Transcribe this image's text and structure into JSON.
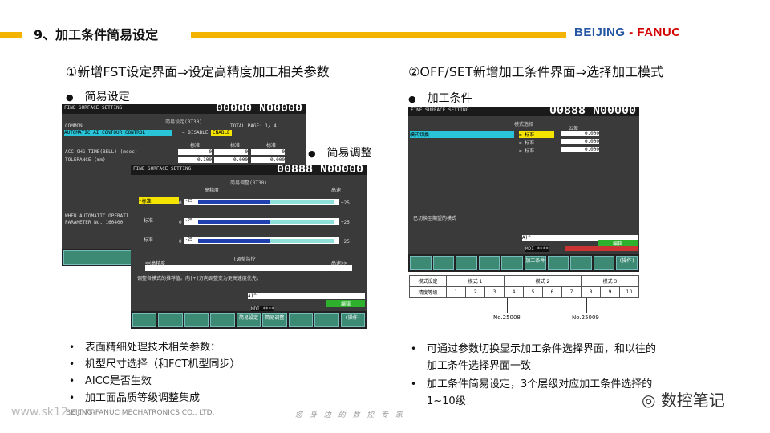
{
  "header": {
    "title": "9、加工条件简易设定",
    "logo_a": "BEIJING",
    "logo_dash": "-",
    "logo_b": "FANUC"
  },
  "left": {
    "subtitle": "①新增FST设定界面⇒设定高精度加工相关参数",
    "bullet1": "简易设定",
    "bullet2": "简易调整"
  },
  "right": {
    "subtitle": "②OFF/SET新增加工条件界面⇒选择加工模式",
    "bullet1": "加工条件"
  },
  "screen1": {
    "title": "FINE SURFACE SETTING",
    "number": "00000 N00000",
    "mode": "简易设定(BT30)",
    "common": "COMMON",
    "total": "TOTAL PAGE:  1/  4",
    "aicc": "AUTOMATIC AI CONTOUR CONTROL",
    "aicc_val": "= DISABLE /",
    "enable": "ENABLE",
    "cols": [
      "标准",
      "标准",
      "标准"
    ],
    "acc_label": "ACC CHG TIME(BELL) (msec)",
    "acc_vals": [
      "0",
      "0",
      "0"
    ],
    "tol_label": "TOLERANCE (mm)",
    "tol_vals": [
      "0.100",
      "0.000",
      "0.000"
    ],
    "warn1": "WHEN AUTOMATIC OPERATI",
    "warn2": "PARAMETER No. 160400"
  },
  "screen2": {
    "title": "FINE SURFACE SETTING",
    "number": "00888 N00000",
    "mode": "简易调整(BT30)",
    "hi": "高精度",
    "hs": "高速",
    "rows": [
      {
        "label": "*标准",
        "val": "0",
        "min": "-25",
        "max": "+25"
      },
      {
        "label": "标准",
        "val": "0",
        "min": "-25",
        "max": "+25"
      },
      {
        "label": "标准",
        "val": "0",
        "min": "-25",
        "max": "+25"
      }
    ],
    "monitor": "(调整监控)",
    "lo_acc": "<<高精度",
    "hi_spd": "高速>>",
    "msg": "调整各模式的推荐值。向[+]方向调整变为更高速度优先。",
    "input": "A)^",
    "mdi": "MDI  ****",
    "edit": "编辑",
    "sk1": "简易设定",
    "sk2": "简易调整",
    "sk3": "(操作)"
  },
  "screen3": {
    "title": "FINE SURFACE SETTING",
    "number": "00888 N00000",
    "mode": "模式选择",
    "tol": "公差",
    "sel": "模式切换",
    "opts": [
      {
        "label": "= 标准",
        "val": "0.000"
      },
      {
        "label": "= 标准",
        "val": "0.000"
      },
      {
        "label": "= 标准",
        "val": "0.000"
      }
    ],
    "msg": "已切换至期望的模式",
    "input": "A)^",
    "mdi": "MDI  ****",
    "edit": "编辑",
    "sk1": "加工条件",
    "sk2": "(操作)"
  },
  "table": {
    "r1": [
      "模式设定",
      "模式 1",
      "模式 2",
      "模式 3"
    ],
    "r2": [
      "精度等级",
      "1",
      "2",
      "3",
      "4",
      "5",
      "6",
      "7",
      "8",
      "9",
      "10"
    ],
    "p1": "No.25008",
    "p2": "No.25009"
  },
  "notes_left": [
    "表面精细处理技术相关参数：",
    "机型尺寸选择（和FCT机型同步）",
    "AICC是否生效",
    "加工面品质等级调整集成"
  ],
  "notes_right": [
    "可通过参数切换显示加工条件选择界面，和以往的加工条件选择界面一致",
    "加工条件简易设定，3个层级对应加工条件选择的1~10级"
  ],
  "footer": {
    "wm": "www.sk12.com",
    "company": "BEIJING-FANUC MECHATRONICS CO., LTD.",
    "slogan": "您 身 边 的 数 控 专 家",
    "wechat": "数控笔记"
  },
  "colors": {
    "accent": "#f2b400",
    "logo_blue": "#2456a5",
    "logo_red": "#d40000"
  }
}
